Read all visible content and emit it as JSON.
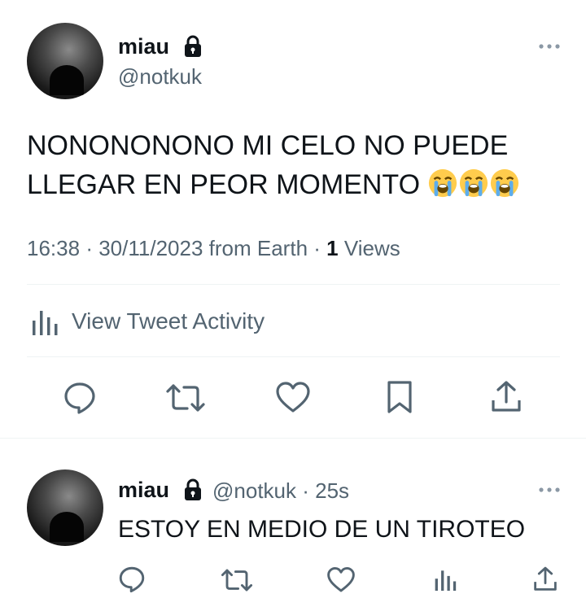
{
  "main_tweet": {
    "display_name": "miau",
    "handle": "@notkuk",
    "text": "NONONONONO MI CELO NO PUEDE LLEGAR EN PEOR MOMENTO",
    "emojis": [
      "loudly-crying-face",
      "loudly-crying-face",
      "loudly-crying-face"
    ],
    "time": "16:38",
    "date": "30/11/2023",
    "source": "from Earth",
    "views_count": "1",
    "views_label": "Views",
    "activity_label": "View Tweet Activity"
  },
  "reply_tweet": {
    "display_name": "miau",
    "handle": "@notkuk",
    "age": "25s",
    "text": "ESTOY EN MEDIO DE UN TIROTEO"
  },
  "icons": {
    "lock": "lock-icon",
    "more": "more-icon",
    "reply": "reply-icon",
    "retweet": "retweet-icon",
    "like": "like-icon",
    "bookmark": "bookmark-icon",
    "share": "share-icon",
    "analytics": "analytics-icon"
  },
  "colors": {
    "text": "#0f1419",
    "secondary": "#536471",
    "divider": "#eff3f4"
  }
}
